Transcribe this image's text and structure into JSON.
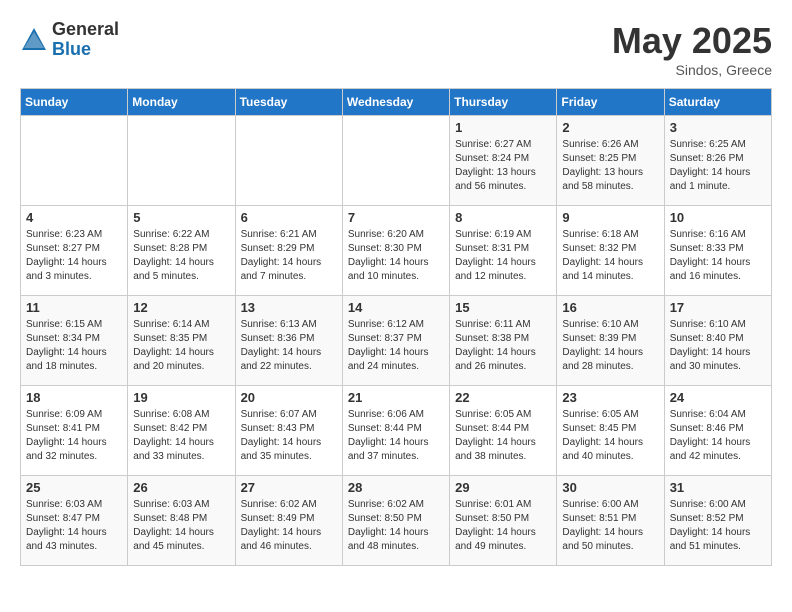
{
  "logo": {
    "general": "General",
    "blue": "Blue"
  },
  "title": "May 2025",
  "location": "Sindos, Greece",
  "days_of_week": [
    "Sunday",
    "Monday",
    "Tuesday",
    "Wednesday",
    "Thursday",
    "Friday",
    "Saturday"
  ],
  "weeks": [
    [
      {
        "day": "",
        "info": ""
      },
      {
        "day": "",
        "info": ""
      },
      {
        "day": "",
        "info": ""
      },
      {
        "day": "",
        "info": ""
      },
      {
        "day": "1",
        "info": "Sunrise: 6:27 AM\nSunset: 8:24 PM\nDaylight: 13 hours and 56 minutes."
      },
      {
        "day": "2",
        "info": "Sunrise: 6:26 AM\nSunset: 8:25 PM\nDaylight: 13 hours and 58 minutes."
      },
      {
        "day": "3",
        "info": "Sunrise: 6:25 AM\nSunset: 8:26 PM\nDaylight: 14 hours and 1 minute."
      }
    ],
    [
      {
        "day": "4",
        "info": "Sunrise: 6:23 AM\nSunset: 8:27 PM\nDaylight: 14 hours and 3 minutes."
      },
      {
        "day": "5",
        "info": "Sunrise: 6:22 AM\nSunset: 8:28 PM\nDaylight: 14 hours and 5 minutes."
      },
      {
        "day": "6",
        "info": "Sunrise: 6:21 AM\nSunset: 8:29 PM\nDaylight: 14 hours and 7 minutes."
      },
      {
        "day": "7",
        "info": "Sunrise: 6:20 AM\nSunset: 8:30 PM\nDaylight: 14 hours and 10 minutes."
      },
      {
        "day": "8",
        "info": "Sunrise: 6:19 AM\nSunset: 8:31 PM\nDaylight: 14 hours and 12 minutes."
      },
      {
        "day": "9",
        "info": "Sunrise: 6:18 AM\nSunset: 8:32 PM\nDaylight: 14 hours and 14 minutes."
      },
      {
        "day": "10",
        "info": "Sunrise: 6:16 AM\nSunset: 8:33 PM\nDaylight: 14 hours and 16 minutes."
      }
    ],
    [
      {
        "day": "11",
        "info": "Sunrise: 6:15 AM\nSunset: 8:34 PM\nDaylight: 14 hours and 18 minutes."
      },
      {
        "day": "12",
        "info": "Sunrise: 6:14 AM\nSunset: 8:35 PM\nDaylight: 14 hours and 20 minutes."
      },
      {
        "day": "13",
        "info": "Sunrise: 6:13 AM\nSunset: 8:36 PM\nDaylight: 14 hours and 22 minutes."
      },
      {
        "day": "14",
        "info": "Sunrise: 6:12 AM\nSunset: 8:37 PM\nDaylight: 14 hours and 24 minutes."
      },
      {
        "day": "15",
        "info": "Sunrise: 6:11 AM\nSunset: 8:38 PM\nDaylight: 14 hours and 26 minutes."
      },
      {
        "day": "16",
        "info": "Sunrise: 6:10 AM\nSunset: 8:39 PM\nDaylight: 14 hours and 28 minutes."
      },
      {
        "day": "17",
        "info": "Sunrise: 6:10 AM\nSunset: 8:40 PM\nDaylight: 14 hours and 30 minutes."
      }
    ],
    [
      {
        "day": "18",
        "info": "Sunrise: 6:09 AM\nSunset: 8:41 PM\nDaylight: 14 hours and 32 minutes."
      },
      {
        "day": "19",
        "info": "Sunrise: 6:08 AM\nSunset: 8:42 PM\nDaylight: 14 hours and 33 minutes."
      },
      {
        "day": "20",
        "info": "Sunrise: 6:07 AM\nSunset: 8:43 PM\nDaylight: 14 hours and 35 minutes."
      },
      {
        "day": "21",
        "info": "Sunrise: 6:06 AM\nSunset: 8:44 PM\nDaylight: 14 hours and 37 minutes."
      },
      {
        "day": "22",
        "info": "Sunrise: 6:05 AM\nSunset: 8:44 PM\nDaylight: 14 hours and 38 minutes."
      },
      {
        "day": "23",
        "info": "Sunrise: 6:05 AM\nSunset: 8:45 PM\nDaylight: 14 hours and 40 minutes."
      },
      {
        "day": "24",
        "info": "Sunrise: 6:04 AM\nSunset: 8:46 PM\nDaylight: 14 hours and 42 minutes."
      }
    ],
    [
      {
        "day": "25",
        "info": "Sunrise: 6:03 AM\nSunset: 8:47 PM\nDaylight: 14 hours and 43 minutes."
      },
      {
        "day": "26",
        "info": "Sunrise: 6:03 AM\nSunset: 8:48 PM\nDaylight: 14 hours and 45 minutes."
      },
      {
        "day": "27",
        "info": "Sunrise: 6:02 AM\nSunset: 8:49 PM\nDaylight: 14 hours and 46 minutes."
      },
      {
        "day": "28",
        "info": "Sunrise: 6:02 AM\nSunset: 8:50 PM\nDaylight: 14 hours and 48 minutes."
      },
      {
        "day": "29",
        "info": "Sunrise: 6:01 AM\nSunset: 8:50 PM\nDaylight: 14 hours and 49 minutes."
      },
      {
        "day": "30",
        "info": "Sunrise: 6:00 AM\nSunset: 8:51 PM\nDaylight: 14 hours and 50 minutes."
      },
      {
        "day": "31",
        "info": "Sunrise: 6:00 AM\nSunset: 8:52 PM\nDaylight: 14 hours and 51 minutes."
      }
    ]
  ]
}
